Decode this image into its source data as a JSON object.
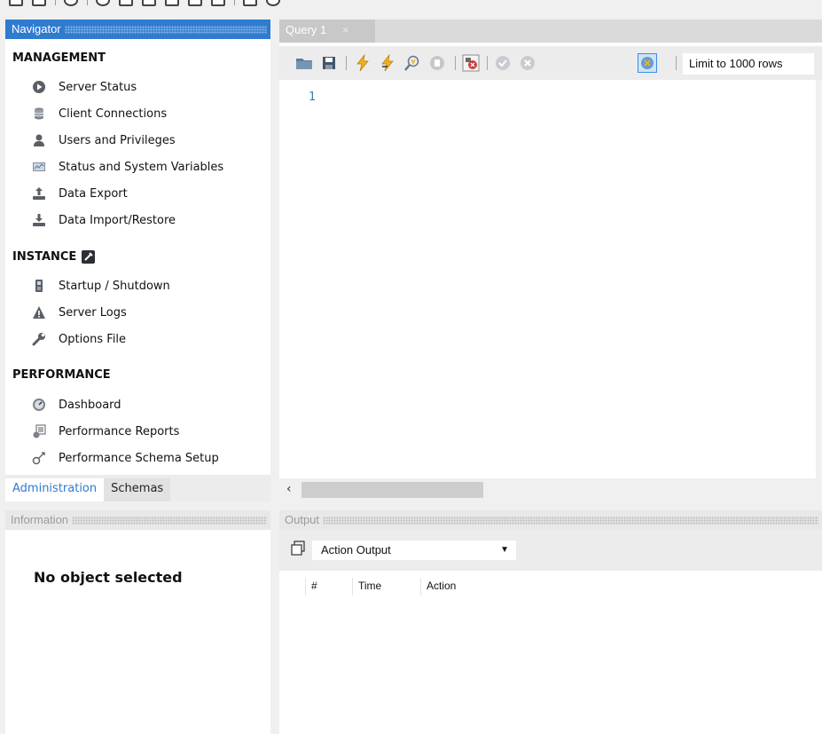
{
  "navigator": {
    "title": "Navigator",
    "sections": [
      {
        "title": "MANAGEMENT",
        "items": [
          {
            "label": "Server Status",
            "icon": "play-circle-icon"
          },
          {
            "label": "Client Connections",
            "icon": "database-icon"
          },
          {
            "label": "Users and Privileges",
            "icon": "user-icon"
          },
          {
            "label": "Status and System Variables",
            "icon": "monitor-chart-icon"
          },
          {
            "label": "Data Export",
            "icon": "export-icon"
          },
          {
            "label": "Data Import/Restore",
            "icon": "import-icon"
          }
        ]
      },
      {
        "title": "INSTANCE",
        "items": [
          {
            "label": "Startup / Shutdown",
            "icon": "power-switch-icon"
          },
          {
            "label": "Server Logs",
            "icon": "warning-icon"
          },
          {
            "label": "Options File",
            "icon": "wrench-icon"
          }
        ]
      },
      {
        "title": "PERFORMANCE",
        "items": [
          {
            "label": "Dashboard",
            "icon": "gauge-icon"
          },
          {
            "label": "Performance Reports",
            "icon": "reports-icon"
          },
          {
            "label": "Performance Schema Setup",
            "icon": "schema-setup-icon"
          }
        ]
      }
    ],
    "tabs": [
      {
        "label": "Administration",
        "active": true
      },
      {
        "label": "Schemas",
        "active": false
      }
    ]
  },
  "information": {
    "title": "Information",
    "message": "No object selected"
  },
  "query": {
    "tab_label": "Query 1",
    "close_glyph": "×",
    "limit_label": "Limit to 1000 rows",
    "line_number": "1"
  },
  "output": {
    "title": "Output",
    "selected": "Action Output",
    "columns": [
      "#",
      "Time",
      "Action"
    ]
  },
  "colors": {
    "accent": "#2f7bcf",
    "header_gray": "#e8e8e8"
  }
}
